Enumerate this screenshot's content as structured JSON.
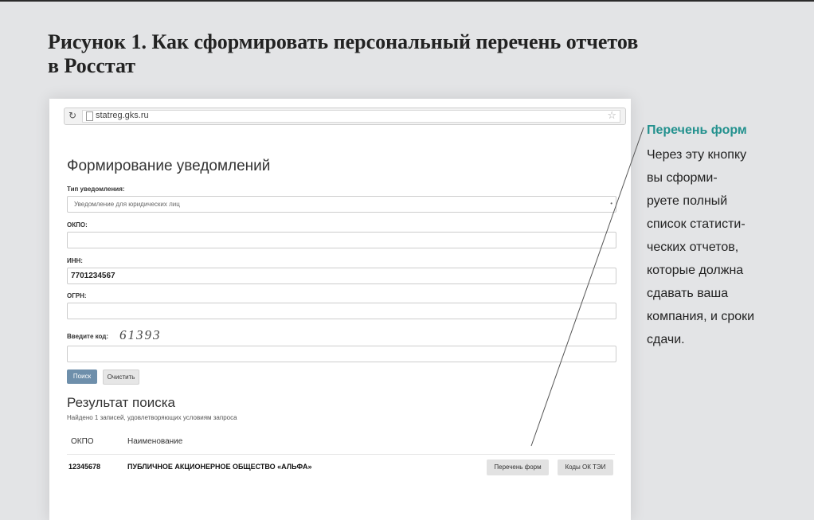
{
  "figure": {
    "title_line1": "Рисунок 1. Как сформировать персональный перечень отчетов",
    "title_line2": "в Росстат"
  },
  "browser": {
    "url": "statreg.gks.ru"
  },
  "form": {
    "heading": "Формирование уведомлений",
    "type_label": "Тип уведомления:",
    "type_value": "Уведомление для юридических лиц",
    "okpo_label": "ОКПО:",
    "okpo_value": "",
    "inn_label": "ИНН:",
    "inn_value": "7701234567",
    "ogrn_label": "ОГРН:",
    "ogrn_value": "",
    "captcha_label": "Введите код:",
    "captcha_value": "61393",
    "code_value": "",
    "search_button": "Поиск",
    "clear_button": "Очистить"
  },
  "results": {
    "heading": "Результат поиска",
    "summary": "Найдено 1 записей, удовлетворяющих условиям запроса",
    "columns": [
      "ОКПО",
      "Наименование"
    ],
    "rows": [
      {
        "okpo": "12345678",
        "name": "ПУБЛИЧНОЕ АКЦИОНЕРНОЕ ОБЩЕСТВО «АЛЬФА»",
        "forms_button": "Перечень форм",
        "codes_button": "Коды ОК ТЭИ"
      }
    ]
  },
  "callout": {
    "title": "Перечень форм",
    "lines": [
      "Через эту кнопку",
      "вы сформи-",
      "руете полный",
      "список статисти-",
      "ческих отчетов,",
      "которые должна",
      "сдавать ваша",
      "компания, и сроки",
      "сдачи."
    ],
    "accent_color": "#23918e"
  }
}
